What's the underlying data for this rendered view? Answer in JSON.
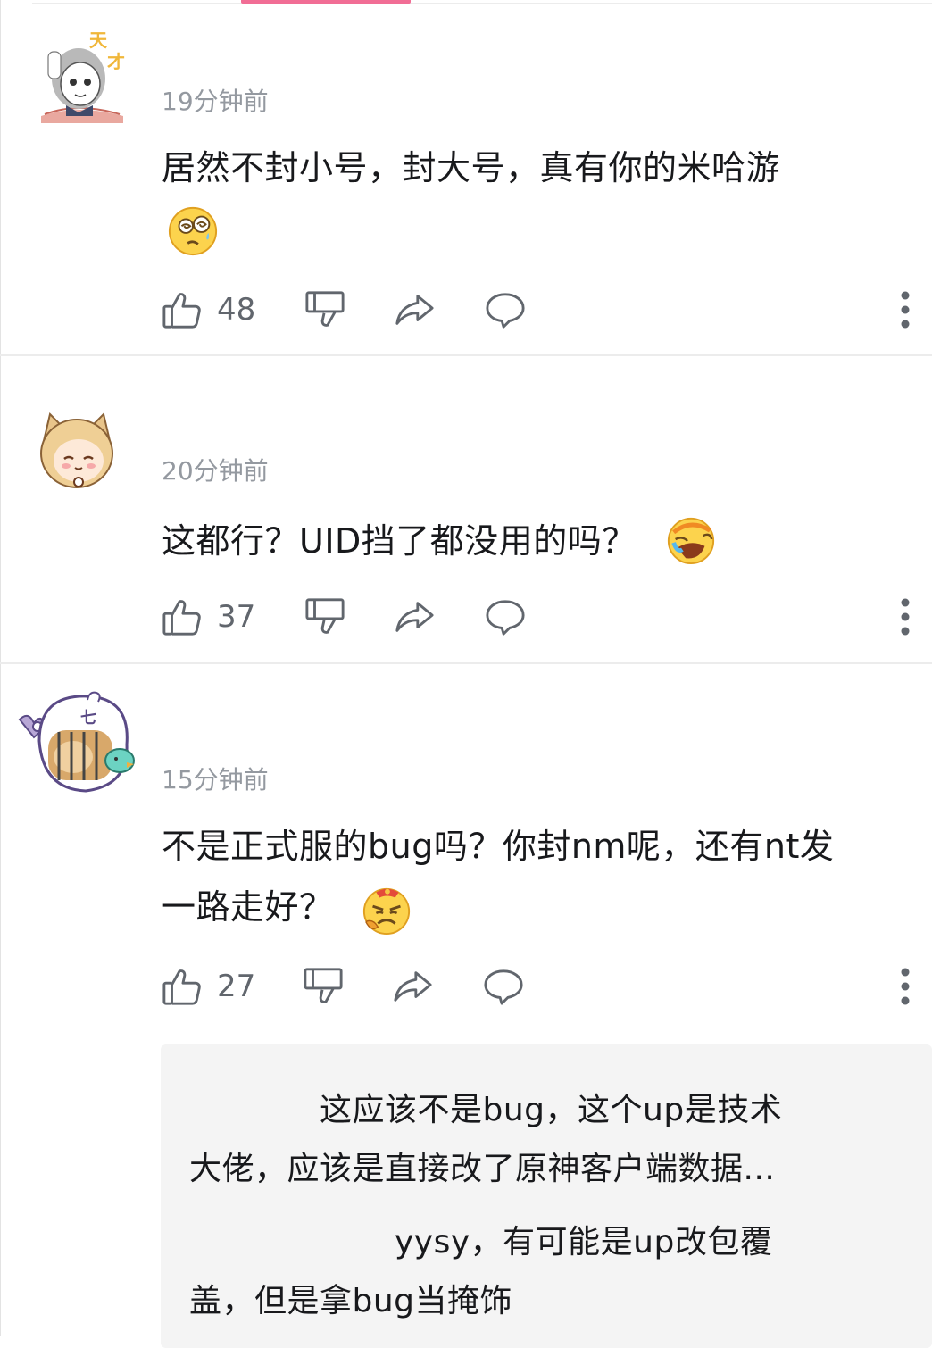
{
  "comments": [
    {
      "time": "19分钟前",
      "text": "居然不封小号，封大号，真有你的米哈游",
      "emoji": "dizzy-face-emoji",
      "likes": "48",
      "avatar": "avatar-girl-with-book-genius"
    },
    {
      "time": "20分钟前",
      "text": "这都行？UID挡了都没用的吗？",
      "emoji": "laughing-crying-emoji",
      "likes": "37",
      "avatar": "avatar-cat-ear-girl"
    },
    {
      "time": "15分钟前",
      "text_line1": "不是正式服的bug吗？你封nm呢，还有nt发",
      "text_line2": "一路走好？",
      "emoji": "angry-grumpy-emoji",
      "likes": "27",
      "avatar": "avatar-ghost-with-dog"
    }
  ],
  "replies": {
    "line1": "这应该不是bug，这个up是技术",
    "line2": "大佬，应该是直接改了原神客户端数据...",
    "line3": "yysy，有可能是up改包覆",
    "line4": "盖，但是拿bug当掩饰"
  },
  "icons": {
    "like": "thumbs-up-icon",
    "dislike": "thumbs-down-icon",
    "share": "share-arrow-icon",
    "reply": "speech-bubble-icon",
    "more": "more-vertical-icon"
  },
  "colors": {
    "accent": "#f16d95",
    "time": "#9499a0",
    "icon": "#61666d",
    "reply_bg": "#f4f4f4"
  }
}
